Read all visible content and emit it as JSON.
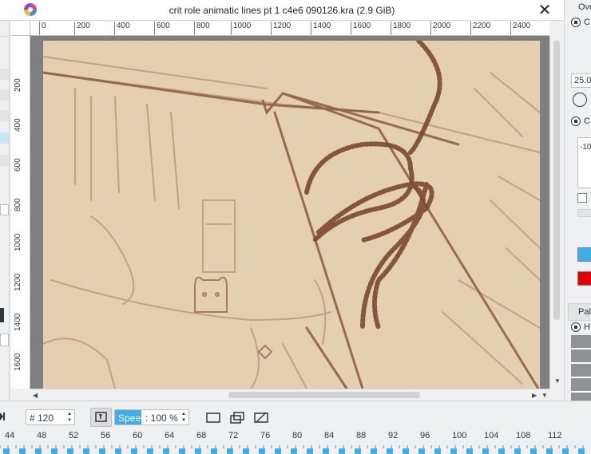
{
  "window": {
    "title": "crit role animatic lines pt 1 c4e6 090126.kra (2.9 GiB)",
    "close_symbol": "✕"
  },
  "ruler": {
    "horizontal": [
      "0",
      "200",
      "400",
      "600",
      "800",
      "1000",
      "1200",
      "1400",
      "1600",
      "1800",
      "2000",
      "2200",
      "2400"
    ],
    "vertical": [
      "200",
      "400",
      "600",
      "800",
      "1000",
      "1200",
      "1400",
      "1600"
    ]
  },
  "right_docker": {
    "tab_label": "Ove",
    "zoom_value": "25.0",
    "spin_value": "-10",
    "palette_tab": "Pale",
    "item_letter_1": "C",
    "item_letter_2": "C",
    "item_letter_3": "H",
    "fg_color": "#3daee9",
    "bg_color": "#e00000"
  },
  "animation": {
    "current_frame": "# 120",
    "speed_label": "Speed",
    "speed_value": ": 100 %",
    "speed_fraction": 0.36
  },
  "timeline": {
    "frame_labels": [
      "44",
      "48",
      "52",
      "56",
      "60",
      "64",
      "68",
      "72",
      "76",
      "80",
      "84",
      "88",
      "92",
      "96",
      "100",
      "104",
      "108",
      "112"
    ]
  },
  "colors": {
    "accent": "#3daee9",
    "canvas_paper": "#e4cfb0",
    "sketch_line": "#8a5a3e"
  }
}
